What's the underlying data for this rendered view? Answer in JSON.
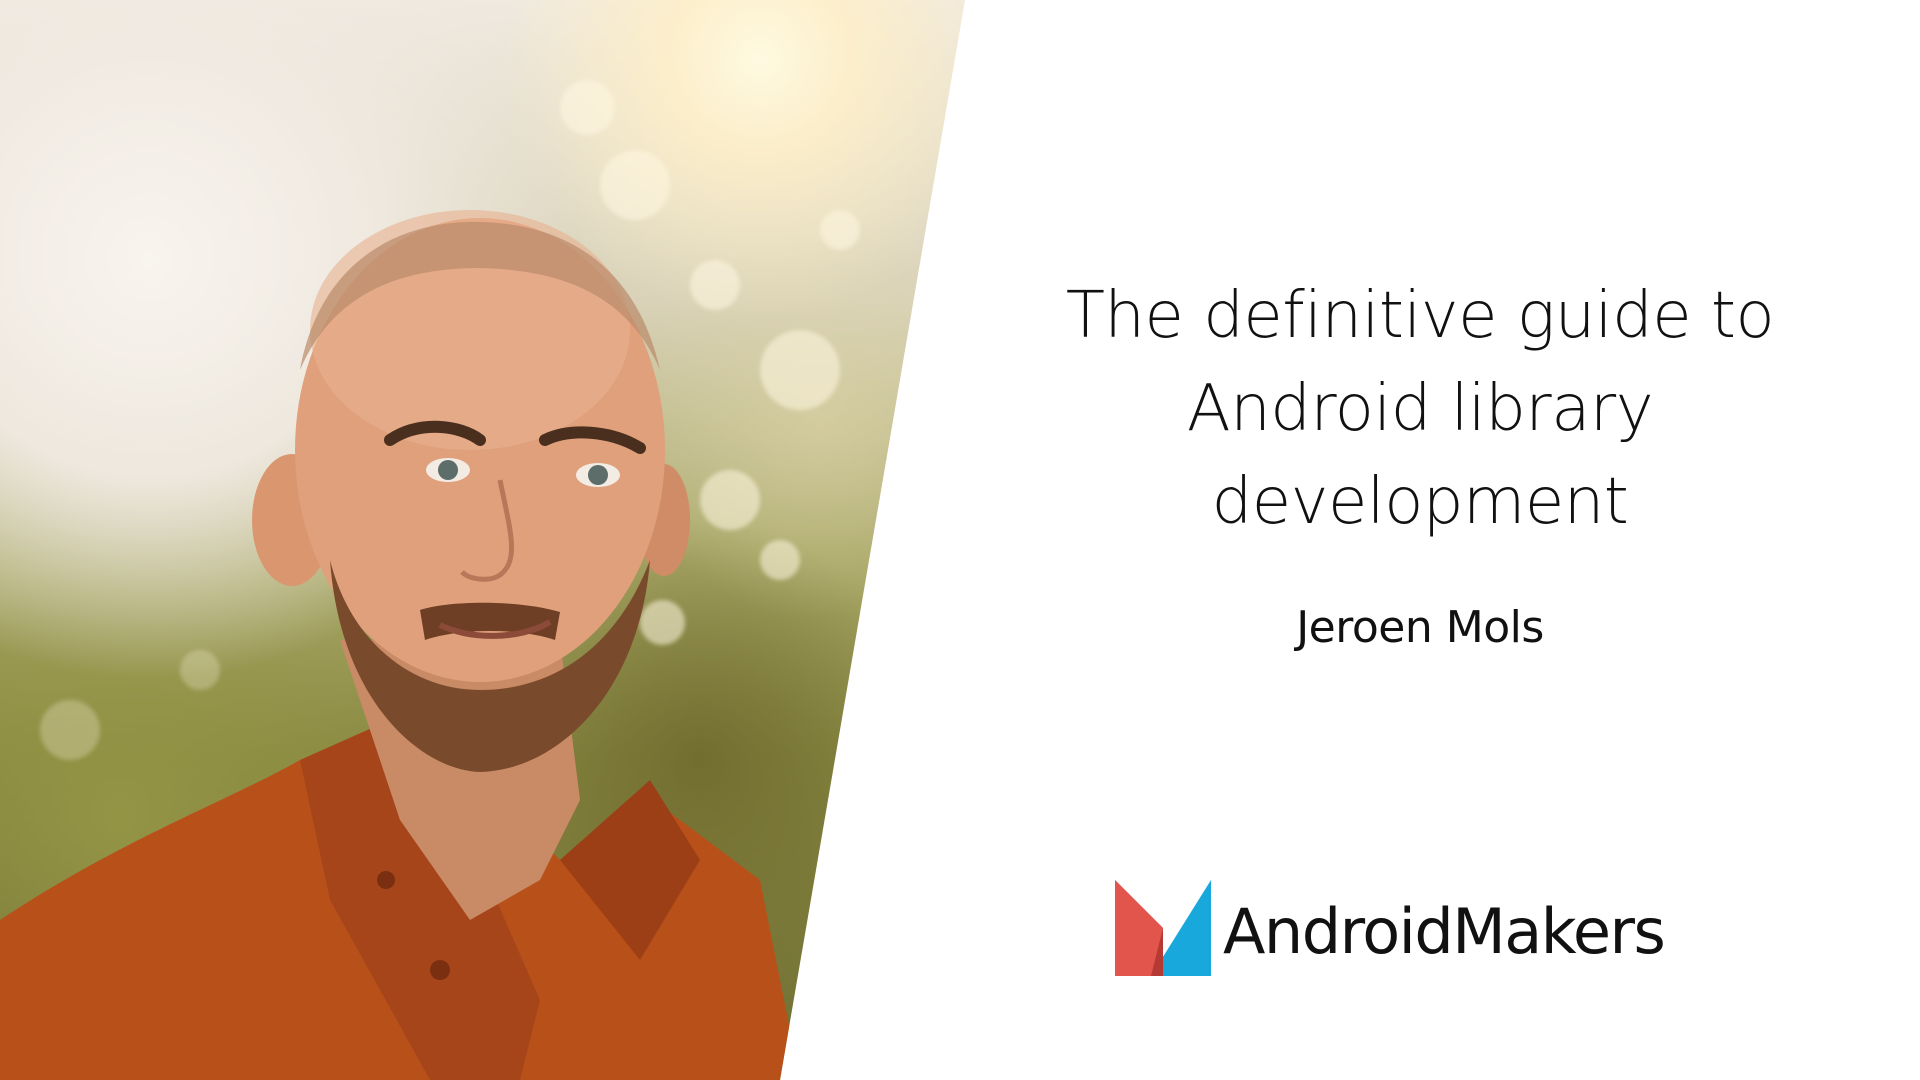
{
  "slide": {
    "title_lines": [
      "The definitive guide to",
      "Android library",
      "development"
    ],
    "author": "Jeroen Mols",
    "brand": {
      "name": "AndroidMakers",
      "logo_icon": "android-makers-logo-icon",
      "colors": {
        "red": "#e2554c",
        "blue": "#19a8db",
        "dark_red": "#b53a33"
      }
    },
    "photo": {
      "description_icon": "speaker-photo",
      "accent_shirt": "#b8501a"
    }
  }
}
